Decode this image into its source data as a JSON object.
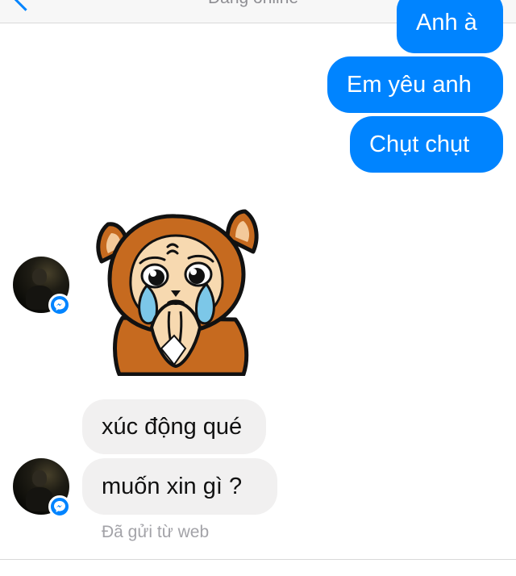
{
  "header": {
    "status": "Đang online"
  },
  "messages": {
    "out_1": "Anh à",
    "out_2": "Em yêu anh",
    "out_3": "Chụt chụt",
    "in_1": "xúc động qué",
    "in_2": "muốn xin gì ?"
  },
  "footer": {
    "sent_via": "Đã gửi từ web"
  },
  "colors": {
    "accent": "#0084ff",
    "incoming_bubble": "#f1f0f0",
    "sticker_fur": "#c66a1f",
    "sticker_face": "#f7d9b0",
    "sticker_tears": "#7cc7e8"
  },
  "icons": {
    "back": "chevron-left-icon",
    "info": "info-icon",
    "badge": "messenger-icon"
  }
}
